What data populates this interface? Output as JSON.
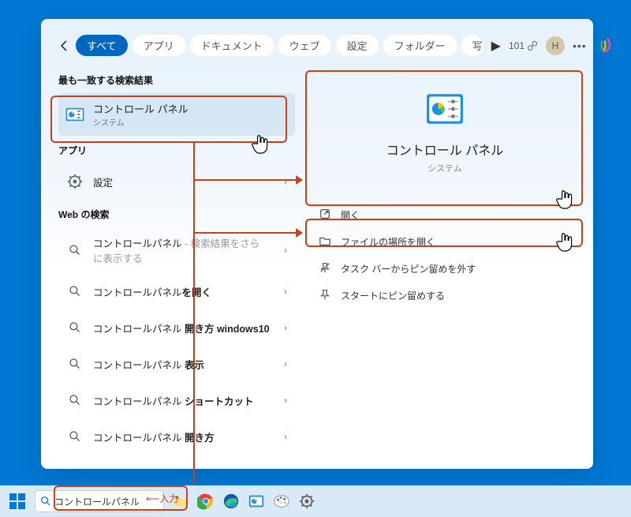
{
  "tabs": {
    "all": "すべて",
    "apps": "アプリ",
    "docs": "ドキュメント",
    "web": "ウェブ",
    "settings": "設定",
    "folders": "フォルダー",
    "photos": "写"
  },
  "points": "101",
  "avatar": "H",
  "sections": {
    "bestmatch": "最も一致する検索結果",
    "apps": "アプリ",
    "websearch": "Web の検索"
  },
  "bestmatch": {
    "title": "コントロール パネル",
    "sub": "システム"
  },
  "app_item": "設定",
  "web": {
    "w1_a": "コントロールパネル",
    "w1_b": " - 検索結果をさらに表示する",
    "w2_a": "コントロールパネル",
    "w2_b": "を開く",
    "w3_a": "コントロールパネル ",
    "w3_b": "開き方 windows10",
    "w4_a": "コントロールパネル ",
    "w4_b": "表示",
    "w5_a": "コントロールパネル ",
    "w5_b": "ショートカット",
    "w6_a": "コントロールパネル ",
    "w6_b": "開き方"
  },
  "preview": {
    "title": "コントロール パネル",
    "sub": "システム"
  },
  "actions": {
    "open": "開く",
    "location": "ファイルの場所を開く",
    "unpin": "タスク バーからピン留めを外す",
    "pin": "スタートにピン留めする"
  },
  "taskbar": {
    "search_value": "コントロールパネル"
  },
  "anno": {
    "input_label": "⟵入力"
  }
}
